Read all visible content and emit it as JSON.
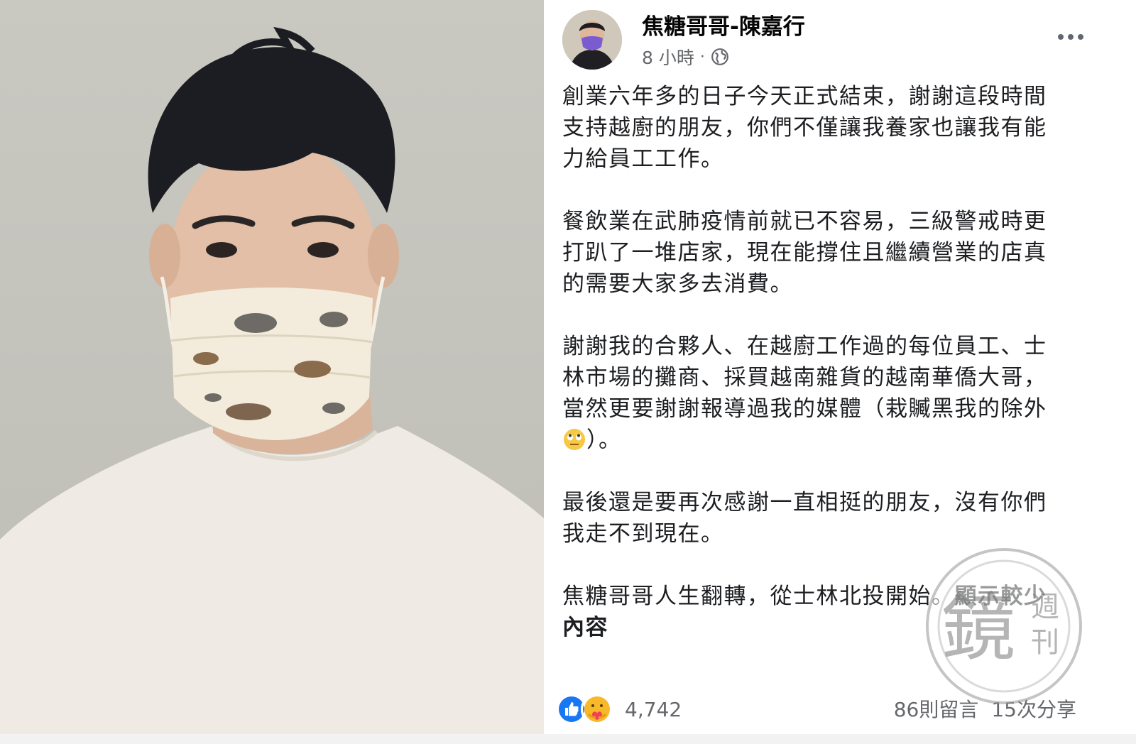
{
  "post": {
    "author": "焦糖哥哥-陳嘉行",
    "time": "8 小時",
    "separator": "·",
    "privacy_icon": "globe-icon",
    "more_icon": "more-horizontal-icon",
    "paragraphs": [
      "創業六年多的日子今天正式結束，謝謝這段時間\n支持越廚的朋友，你們不僅讓我養家也讓我有能\n力給員工工作。",
      "餐飲業在武肺疫情前就已不容易，三級警戒時更\n打趴了一堆店家，現在能撐住且繼續營業的店真\n的需要大家多去消費。",
      "謝謝我的合夥人、在越廚工作過的每位員工、士\n林市場的攤商、採買越南雜貨的越南華僑大哥，\n當然更要謝謝報導過我的媒體（栽贓黑我的除外",
      "最後還是要再次感謝一直相挺的朋友，沒有你們\n我走不到現在。"
    ],
    "paragraph3_tail": "）。",
    "last_line": "焦糖哥哥人生翻轉，從士林北投開始。",
    "see_less": "顯示較少\n內容",
    "emoji_icon": "eye-roll-emoji-icon"
  },
  "reactions": {
    "icons": [
      "like-icon",
      "care-icon"
    ],
    "count": "4,742",
    "comments": "86則留言",
    "shares": "15次分享"
  },
  "colors": {
    "like_blue": "#1877f2",
    "care_yellow": "#f7b928",
    "secondary_text": "#65676b",
    "photo_bg": "#c6c5be"
  },
  "watermark": {
    "icon": "mirror-media-logo-icon",
    "text": "鏡週刊"
  }
}
